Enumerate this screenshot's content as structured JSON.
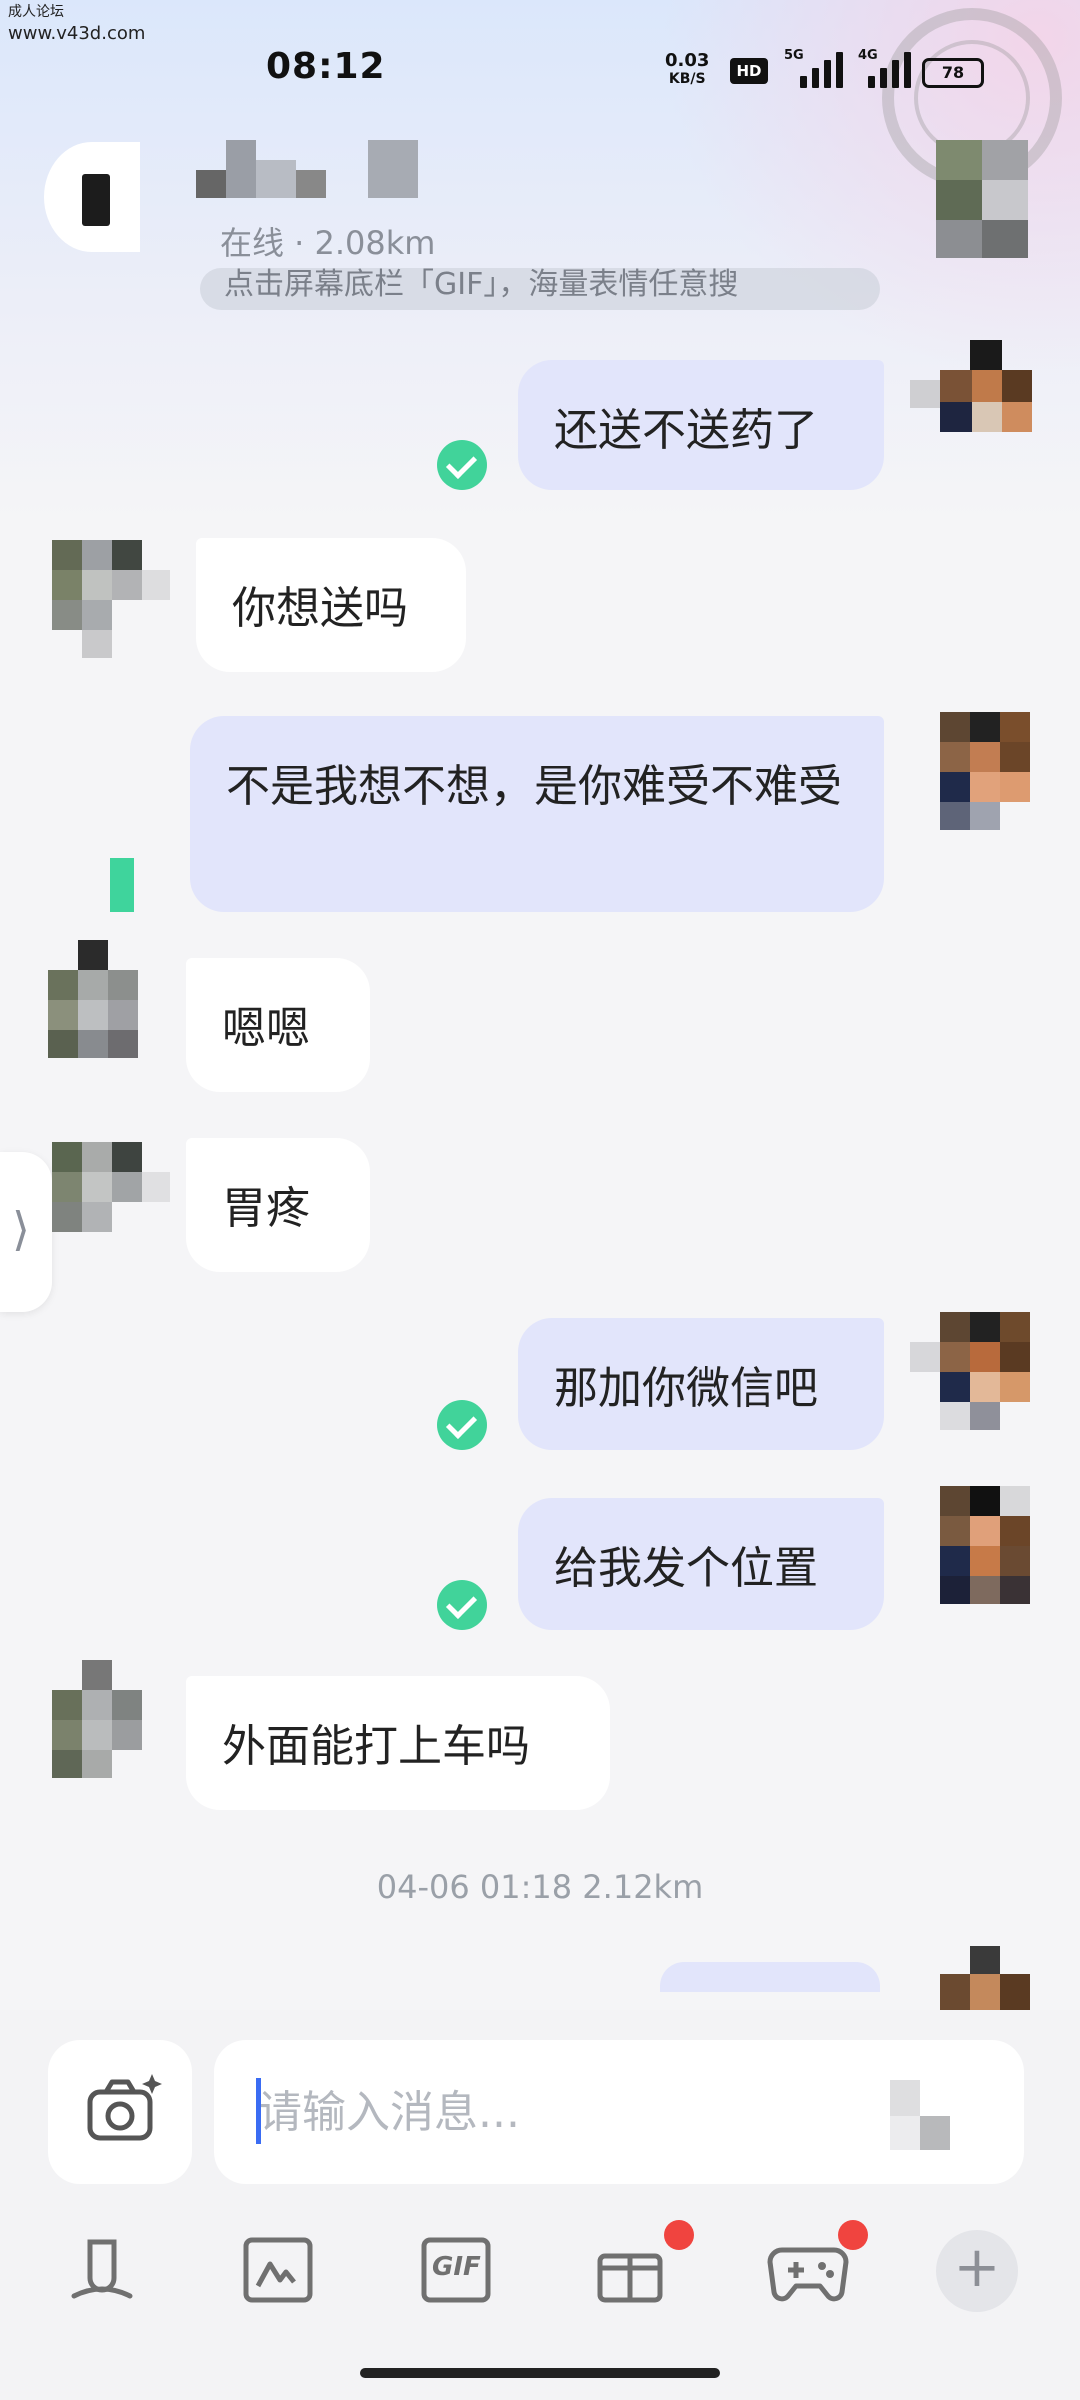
{
  "watermark": {
    "site": "成人论坛",
    "url": "www.v43d.com"
  },
  "status_bar": {
    "time": "08:12",
    "net_speed_value": "0.03",
    "net_speed_unit": "KB/S",
    "hd_label": "HD",
    "signal_tag_1": "5G",
    "signal_tag_2": "4G",
    "battery": "78"
  },
  "header": {
    "subtitle": "在线 · 2.08km",
    "hint": "点击屏幕底栏「GIF」，海量表情任意搜"
  },
  "messages": [
    {
      "side": "me",
      "text": "还送不送药了",
      "read": true
    },
    {
      "side": "them",
      "text": "你想送吗"
    },
    {
      "side": "me",
      "text": "不是我想不想，是你难受不难受",
      "read": false
    },
    {
      "side": "them",
      "text": "嗯嗯"
    },
    {
      "side": "them",
      "text": "胃疼"
    },
    {
      "side": "me",
      "text": "那加你微信吧",
      "read": true
    },
    {
      "side": "me",
      "text": "给我发个位置",
      "read": true
    },
    {
      "side": "them",
      "text": "外面能打上车吗"
    }
  ],
  "timestamp": "04-06 01:18  2.12km",
  "input": {
    "placeholder": "请输入消息..."
  },
  "side_handle": "⟩",
  "toolbar": {
    "items": [
      "voice-icon",
      "image-icon",
      "gif-icon",
      "gift-icon",
      "game-icon",
      "plus-icon"
    ],
    "gif_label": "GIF",
    "plus_label": "+"
  },
  "colors": {
    "accent_green": "#41d39a",
    "my_bubble": "#e2e5fb",
    "badge": "#f0443f"
  }
}
